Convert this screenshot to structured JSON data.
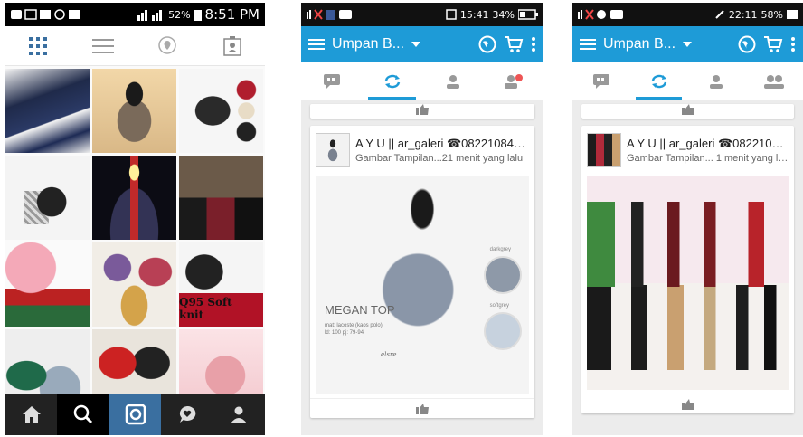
{
  "screen1": {
    "status": {
      "time": "8:51 PM",
      "battery": "52%"
    },
    "grid_label": "Q95 Soft knit"
  },
  "screen2": {
    "status": {
      "time": "15:41",
      "battery": "34%"
    },
    "appbar_title": "Umpan B...",
    "post": {
      "name": "A Y U || ar_galeri ☎082210845...",
      "subtitle": "Gambar Tampilan...21 menit yang lalu",
      "product_name": "MEGAN TOP",
      "material": "mat: lacoste (kaos polo) ld: 100 pj: 79-94",
      "colors": [
        "darkgrey",
        "softgrey"
      ],
      "brand": "elsre"
    }
  },
  "screen3": {
    "status": {
      "time": "22:11",
      "battery": "58%"
    },
    "appbar_title": "Umpan B...",
    "post": {
      "name": "A Y U || ar_galeri ☎082210845...",
      "subtitle": "Gambar Tampilan... 1 menit yang lalu"
    }
  },
  "colors": {
    "bbm_blue": "#1e9bd7",
    "ig_nav": "#222222",
    "ig_active": "#3a6fa0"
  }
}
